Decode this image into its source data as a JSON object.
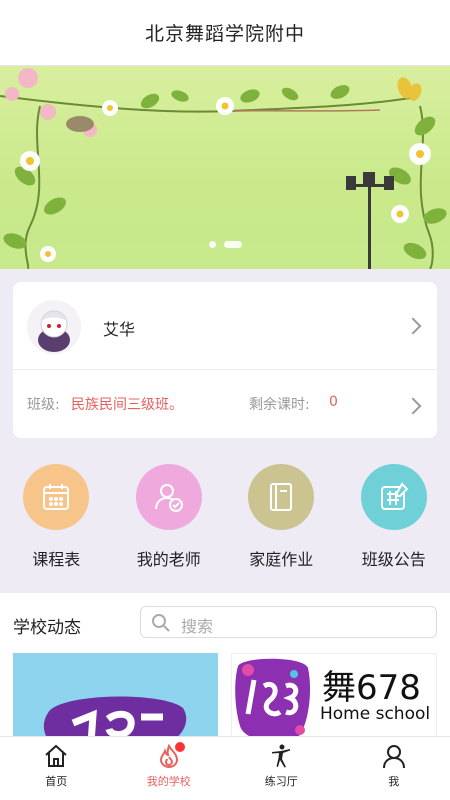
{
  "header": {
    "title": "北京舞蹈学院附中"
  },
  "banner": {
    "slide_count": 2,
    "active_slide": 2
  },
  "profile": {
    "name": "艾华",
    "class_label": "班级:",
    "class_value": "民族民间三级班。",
    "remaining_label": "剩余课时:",
    "remaining_value": "0"
  },
  "shortcuts": [
    {
      "label": "课程表",
      "color": "#f7c58a",
      "icon": "calendar-icon"
    },
    {
      "label": "我的老师",
      "color": "#f0a9dc",
      "icon": "teacher-icon"
    },
    {
      "label": "家庭作业",
      "color": "#cbc491",
      "icon": "notebook-icon"
    },
    {
      "label": "班级公告",
      "color": "#6fd0d8",
      "icon": "notice-icon"
    }
  ],
  "news": {
    "title": "学校动态",
    "search_placeholder": "搜索",
    "tile2_brand": "舞678",
    "tile2_sub": "Home school"
  },
  "tabs": [
    {
      "label": "首页",
      "icon": "home-icon"
    },
    {
      "label": "我的学校",
      "icon": "flame-icon",
      "active": true
    },
    {
      "label": "练习厅",
      "icon": "dancer-icon"
    },
    {
      "label": "我",
      "icon": "person-icon"
    }
  ],
  "colors": {
    "accent": "#e8615f",
    "banner": "#c9e98a"
  }
}
